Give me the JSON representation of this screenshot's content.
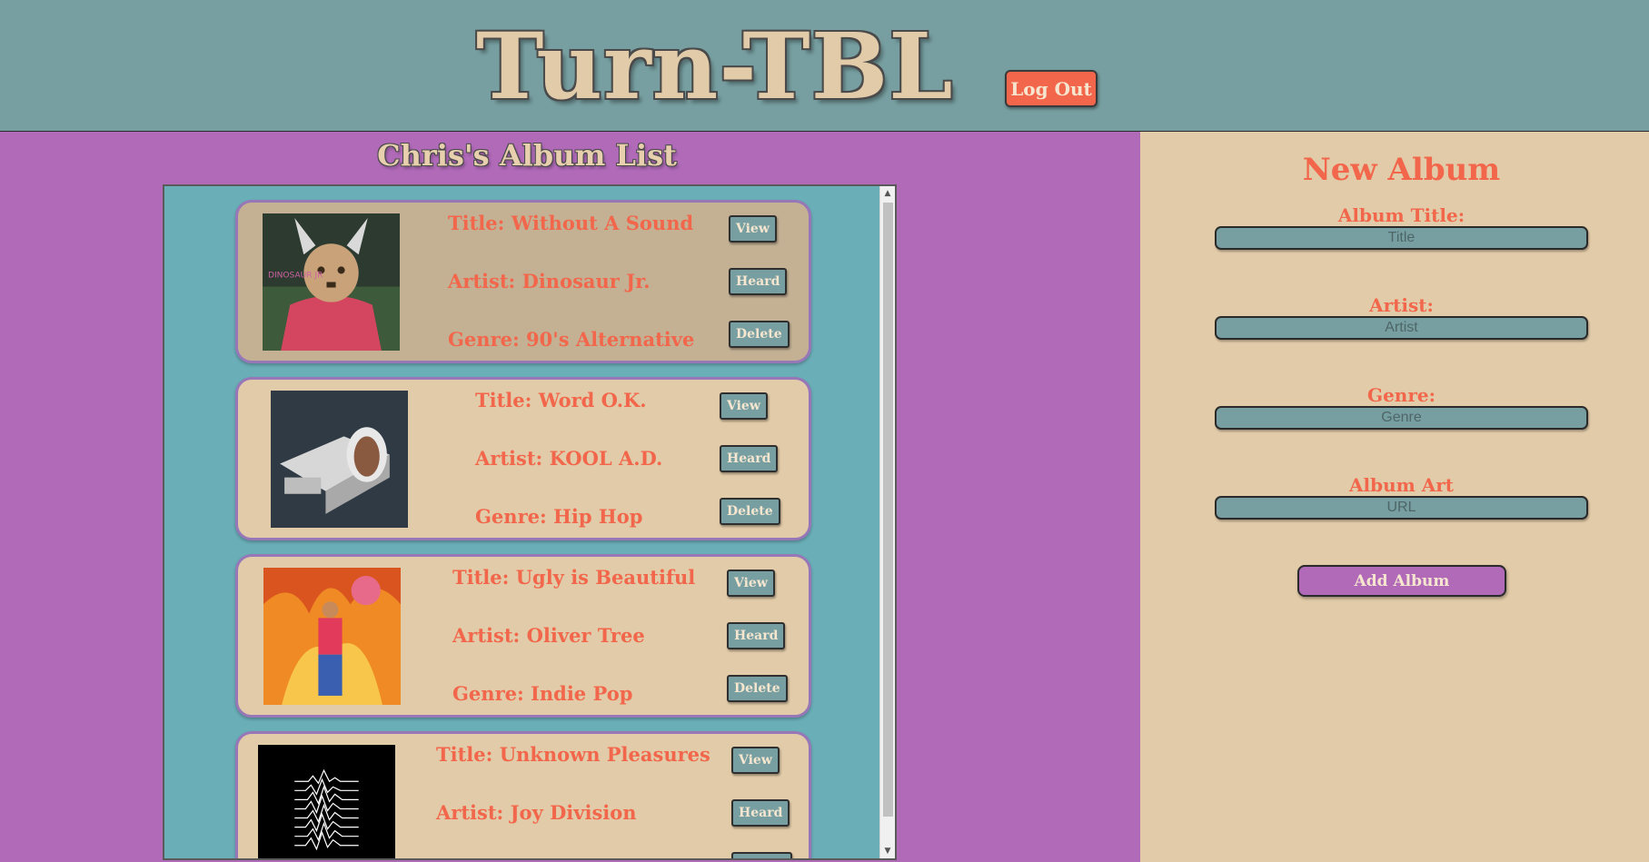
{
  "header": {
    "logo": "Turn-TBL",
    "logout_label": "Log Out"
  },
  "list": {
    "title": "Chris's Album List",
    "albums": [
      {
        "title": "Title: Without A Sound",
        "artist": "Artist: Dinosaur Jr.",
        "genre": "Genre: 90's Alternative"
      },
      {
        "title": "Title: Word O.K.",
        "artist": "Artist: KOOL A.D.",
        "genre": "Genre: Hip Hop"
      },
      {
        "title": "Title: Ugly is Beautiful",
        "artist": "Artist: Oliver Tree",
        "genre": "Genre: Indie Pop"
      },
      {
        "title": "Title: Unknown Pleasures",
        "artist": "Artist: Joy Division",
        "genre": ""
      }
    ],
    "buttons": {
      "view": "View",
      "heard": "Heard",
      "delete": "Delete"
    }
  },
  "form": {
    "title": "New Album",
    "title_label": "Album Title:",
    "title_placeholder": "Title",
    "artist_label": "Artist:",
    "artist_placeholder": "Artist",
    "genre_label": "Genre:",
    "genre_placeholder": "Genre",
    "art_label": "Album Art",
    "art_placeholder": "URL",
    "submit_label": "Add Album"
  },
  "colors": {
    "header_bg": "#779fa1",
    "page_bg": "#b06ab8",
    "accent": "#f2674b",
    "cream": "#e2cba8",
    "list_bg": "#6aaeb8"
  }
}
